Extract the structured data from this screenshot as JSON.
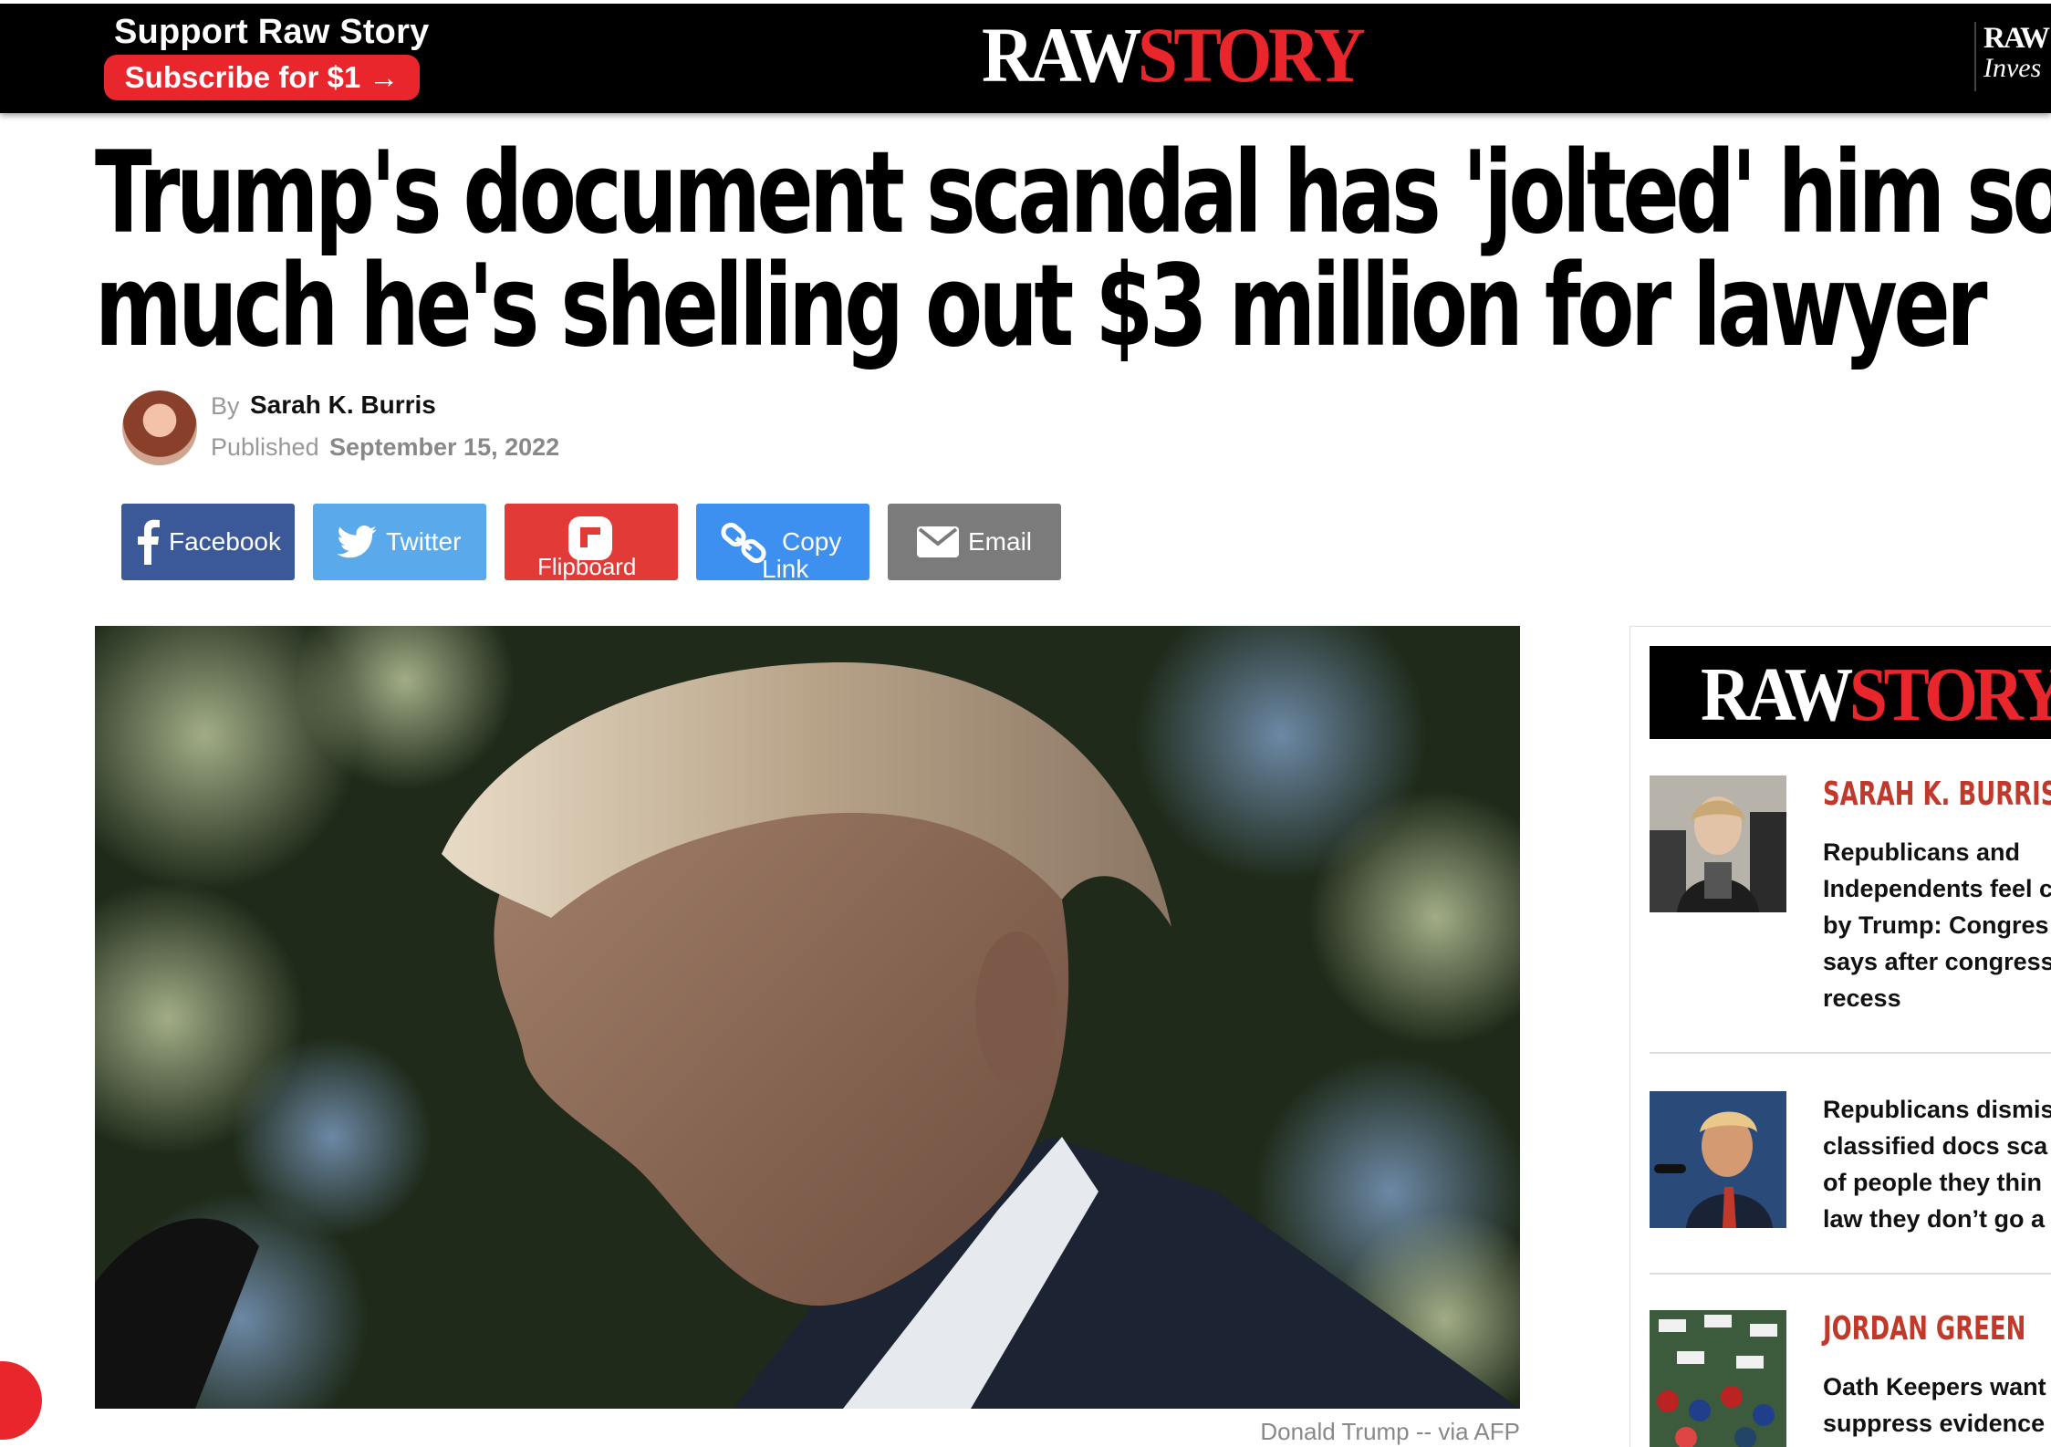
{
  "topbar": {
    "support_title": "Support Raw Story",
    "subscribe_label": "Subscribe for $1 →",
    "logo_white": "RAW",
    "logo_red": "STORY",
    "mini_logo_line1": "RAW",
    "mini_logo_line2": "Inves"
  },
  "article": {
    "headline_line1": "Trump's document scandal has 'jolted' him so",
    "headline_line2": "much he's shelling out $3 million for lawyer",
    "by_label": "By",
    "author": "Sarah K. Burris",
    "published_label": "Published",
    "published_date": "September 15, 2022",
    "image_caption": "Donald Trump -- via AFP"
  },
  "share": {
    "facebook": "Facebook",
    "twitter": "Twitter",
    "flipboard": "Flipboard",
    "copy_line1": "Copy",
    "copy_line2": "Link",
    "email": "Email"
  },
  "sidebar": {
    "logo_white": "RAW",
    "logo_red": "STORY",
    "items": [
      {
        "author": "SARAH K. BURRIS",
        "text": "Republicans and\nIndependents feel c\nby Trump: Congres\nsays after congress\nrecess"
      },
      {
        "author": "",
        "text": "Republicans dismis\nclassified docs sca\nof people they thin\nlaw they don’t go a"
      },
      {
        "author": "JORDAN GREEN",
        "text": "Oath Keepers want\nsuppress evidence"
      }
    ]
  },
  "colors": {
    "brand_red": "#e8262b",
    "facebook": "#3b5998",
    "twitter": "#5aa9ea",
    "flipboard": "#e23a37",
    "copy_link": "#3d8ff0",
    "email": "#7b7b7b",
    "sidebar_author": "#c0392b"
  },
  "icons": [
    "facebook-icon",
    "twitter-icon",
    "flipboard-icon",
    "link-icon",
    "envelope-icon"
  ]
}
